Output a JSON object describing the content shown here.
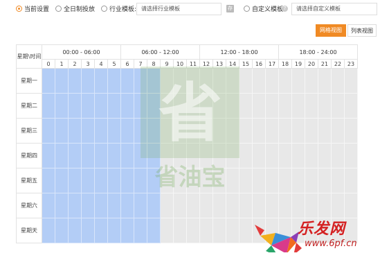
{
  "toolbar": {
    "options": [
      {
        "label": "当前设置",
        "selected": true
      },
      {
        "label": "全日制投放",
        "selected": false
      },
      {
        "label": "行业模板:",
        "selected": false
      },
      {
        "label": "自定义模板:",
        "selected": false
      }
    ],
    "industry_select_placeholder": "请选择行业模板",
    "custom_select_placeholder": "请选择自定义模板",
    "icon_label": "存",
    "help_icon_label": "?"
  },
  "view_switch": {
    "grid_label": "网格视图",
    "list_label": "列表视图",
    "active": "grid"
  },
  "grid": {
    "corner_label": "星期\\时间",
    "time_groups": [
      "00:00 - 06:00",
      "06:00 - 12:00",
      "12:00 - 18:00",
      "18:00 - 24:00"
    ],
    "hours": [
      "0",
      "1",
      "2",
      "3",
      "4",
      "5",
      "6",
      "7",
      "8",
      "9",
      "10",
      "11",
      "12",
      "13",
      "14",
      "15",
      "16",
      "17",
      "18",
      "19",
      "20",
      "21",
      "22",
      "23"
    ],
    "days": [
      "星期一",
      "星期二",
      "星期三",
      "星期四",
      "星期五",
      "星期六",
      "星期天"
    ],
    "selected_hours": [
      0,
      1,
      2,
      3,
      4,
      5,
      6,
      7,
      8
    ]
  },
  "watermark": {
    "glyph": "省",
    "text": "省油宝"
  },
  "site_logo": {
    "name": "乐发网",
    "url": "www.6pf.cn"
  },
  "colors": {
    "accent": "#f08a24",
    "selected_cell": "#b3cdf6",
    "unselected_cell": "#e8e8e8"
  }
}
